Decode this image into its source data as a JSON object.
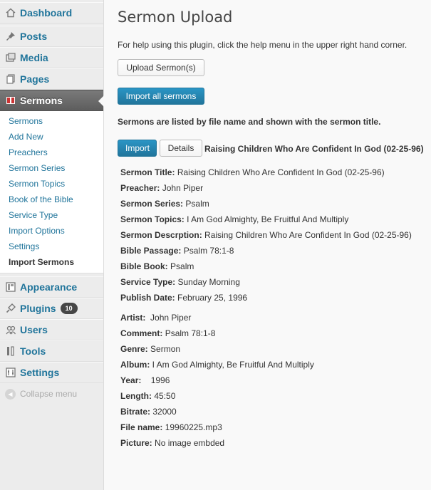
{
  "sidebar": {
    "dashboard": "Dashboard",
    "posts": "Posts",
    "media": "Media",
    "pages": "Pages",
    "sermons": "Sermons",
    "submenu": [
      "Sermons",
      "Add New",
      "Preachers",
      "Sermon Series",
      "Sermon Topics",
      "Book of the Bible",
      "Service Type",
      "Import Options",
      "Settings",
      "Import Sermons"
    ],
    "appearance": "Appearance",
    "plugins": "Plugins",
    "plugins_badge": "10",
    "users": "Users",
    "tools": "Tools",
    "settings": "Settings",
    "collapse": "Collapse menu"
  },
  "main": {
    "title": "Sermon Upload",
    "help_text": "For help using this plugin, click the help menu in the upper right hand corner.",
    "upload_button": "Upload Sermon(s)",
    "import_all_button": "Import all sermons",
    "listed_text": "Sermons are listed by file name and shown with the sermon title.",
    "import_button": "Import",
    "details_button": "Details",
    "sermon_title": "Raising Children Who Are Confident In God (02-25-96)"
  },
  "details": {
    "sermon_title_label": "Sermon Title:",
    "sermon_title": "Raising Children Who Are Confident In God (02-25-96)",
    "preacher_label": "Preacher:",
    "preacher": "John Piper",
    "series_label": "Sermon Series:",
    "series": "Psalm",
    "topics_label": "Sermon Topics:",
    "topics": "I Am God Almighty, Be Fruitful And Multiply",
    "description_label": "Sermon Descrption:",
    "description": "Raising Children Who Are Confident In God (02-25-96)",
    "passage_label": "Bible Passage:",
    "passage": "Psalm 78:1-8",
    "book_label": "Bible Book:",
    "book": "Psalm",
    "service_label": "Service Type:",
    "service": "Sunday Morning",
    "publish_label": "Publish Date:",
    "publish": "February 25, 1996",
    "artist_label": "Artist:",
    "artist": "John Piper",
    "comment_label": "Comment:",
    "comment": "Psalm 78:1-8",
    "genre_label": "Genre:",
    "genre": "Sermon",
    "album_label": "Album:",
    "album": "I Am God Almighty, Be Fruitful And Multiply",
    "year_label": "Year:",
    "year": "1996",
    "length_label": "Length:",
    "length": "45:50",
    "bitrate_label": "Bitrate:",
    "bitrate": "32000",
    "filename_label": "File name:",
    "filename": "19960225.mp3",
    "picture_label": "Picture:",
    "picture": "No image embded"
  },
  "colors": {
    "link": "#21759b",
    "primary_button": "#21759b",
    "active_menu": "#6d6d6d"
  }
}
